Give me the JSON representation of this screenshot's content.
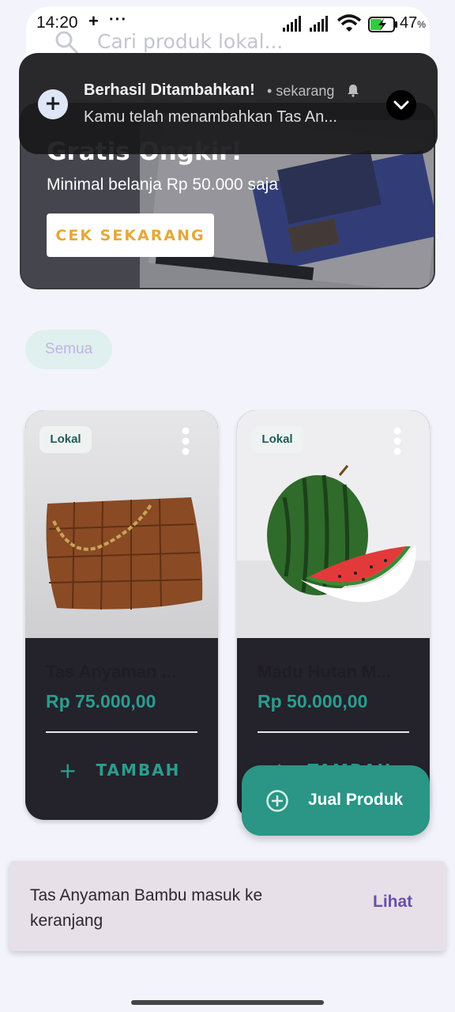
{
  "status_bar": {
    "time": "14:20",
    "plus": "+",
    "dots": "···",
    "battery_percent": "47",
    "battery_unit": "%"
  },
  "search": {
    "placeholder": "Cari produk lokal..."
  },
  "notification": {
    "title": "Berhasil Ditambahkan!",
    "time": "• sekarang",
    "body": "Kamu telah menambahkan Tas An...",
    "app_icon": "plus-icon",
    "expand_icon": "chevron-down-icon"
  },
  "banner": {
    "title": "Gratis Ongkir!",
    "subtitle": "Minimal belanja Rp 50.000 saja",
    "cta_label": "CEK SEKARANG"
  },
  "filters": {
    "items": [
      {
        "label": "Semua",
        "selected": true
      }
    ]
  },
  "products": [
    {
      "badge": "Lokal",
      "name": "Tas Anyaman ...",
      "price": "Rp 75.000,00",
      "add_label": "TAMBAH",
      "image": "leather-bag"
    },
    {
      "badge": "Lokal",
      "name": "Madu Hutan M...",
      "price": "Rp 50.000,00",
      "add_label": "TAMBAH",
      "image": "watermelon"
    }
  ],
  "fab": {
    "label": "Jual Produk",
    "icon": "plus-circle-icon"
  },
  "snackbar": {
    "message": "Tas Anyaman Bambu masuk ke keranjang",
    "action_label": "Lihat"
  },
  "colors": {
    "accent": "#2a9d8f",
    "card_bg": "#24222b",
    "snackbar_bg": "#e7e0e8",
    "snackbar_action": "#6a4fa8",
    "banner_cta_text": "#e4a93a"
  }
}
